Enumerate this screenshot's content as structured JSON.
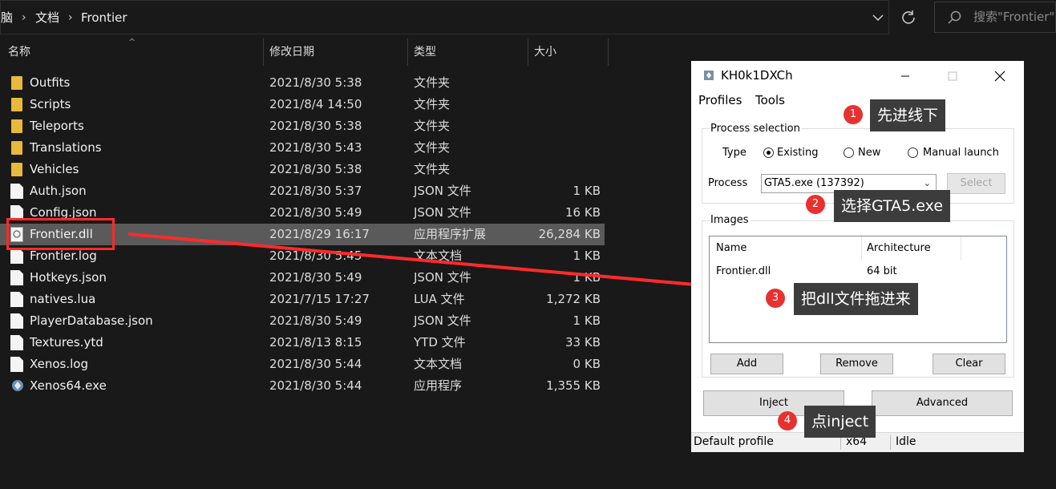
{
  "explorer": {
    "breadcrumb": [
      "脑",
      "文档",
      "Frontier"
    ],
    "search_placeholder": "搜索\"Frontier\"",
    "columns": {
      "name": "名称",
      "date": "修改日期",
      "type": "类型",
      "size": "大小"
    },
    "files": [
      {
        "name": "Outfits",
        "date": "2021/8/30 5:38",
        "type": "文件夹",
        "size": "",
        "kind": "folder"
      },
      {
        "name": "Scripts",
        "date": "2021/8/4 14:50",
        "type": "文件夹",
        "size": "",
        "kind": "folder"
      },
      {
        "name": "Teleports",
        "date": "2021/8/30 5:38",
        "type": "文件夹",
        "size": "",
        "kind": "folder"
      },
      {
        "name": "Translations",
        "date": "2021/8/30 5:43",
        "type": "文件夹",
        "size": "",
        "kind": "folder"
      },
      {
        "name": "Vehicles",
        "date": "2021/8/30 5:38",
        "type": "文件夹",
        "size": "",
        "kind": "folder"
      },
      {
        "name": "Auth.json",
        "date": "2021/8/30 5:37",
        "type": "JSON 文件",
        "size": "1 KB",
        "kind": "file"
      },
      {
        "name": "Config.json",
        "date": "2021/8/30 5:49",
        "type": "JSON 文件",
        "size": "16 KB",
        "kind": "file"
      },
      {
        "name": "Frontier.dll",
        "date": "2021/8/29 16:17",
        "type": "应用程序扩展",
        "size": "26,284 KB",
        "kind": "dll"
      },
      {
        "name": "Frontier.log",
        "date": "2021/8/30 5:45",
        "type": "文本文档",
        "size": "1 KB",
        "kind": "file"
      },
      {
        "name": "Hotkeys.json",
        "date": "2021/8/30 5:49",
        "type": "JSON 文件",
        "size": "1 KB",
        "kind": "file"
      },
      {
        "name": "natives.lua",
        "date": "2021/7/15 17:27",
        "type": "LUA 文件",
        "size": "1,272 KB",
        "kind": "file"
      },
      {
        "name": "PlayerDatabase.json",
        "date": "2021/8/30 5:49",
        "type": "JSON 文件",
        "size": "1 KB",
        "kind": "file"
      },
      {
        "name": "Textures.ytd",
        "date": "2021/8/13 8:15",
        "type": "YTD 文件",
        "size": "33 KB",
        "kind": "file"
      },
      {
        "name": "Xenos.log",
        "date": "2021/8/30 5:44",
        "type": "文本文档",
        "size": "0 KB",
        "kind": "file"
      },
      {
        "name": "Xenos64.exe",
        "date": "2021/8/30 5:44",
        "type": "应用程序",
        "size": "1,355 KB",
        "kind": "exe"
      }
    ],
    "selected_file": "Frontier.dll"
  },
  "dialog": {
    "title": "KH0k1DXCh",
    "menu": [
      "Profiles",
      "Tools"
    ],
    "process_selection": {
      "label": "Process selection",
      "type_label": "Type",
      "options": [
        "Existing",
        "New",
        "Manual launch"
      ],
      "selected_option": "Existing",
      "process_label": "Process",
      "process_value": "GTA5.exe (137392)",
      "select_button": "Select"
    },
    "images": {
      "label": "Images",
      "columns": [
        "Name",
        "Architecture"
      ],
      "rows": [
        {
          "name": "Frontier.dll",
          "arch": "64 bit"
        }
      ],
      "buttons": [
        "Add",
        "Remove",
        "Clear"
      ]
    },
    "inject_button": "Inject",
    "advanced_button": "Advanced",
    "status": {
      "profile": "Default profile",
      "arch": "x64",
      "state": "Idle"
    }
  },
  "annotations": [
    {
      "num": "1",
      "text": "先进线下"
    },
    {
      "num": "2",
      "text": "选择GTA5.exe"
    },
    {
      "num": "3",
      "text": "把dll文件拖进来"
    },
    {
      "num": "4",
      "text": "点inject"
    }
  ],
  "colors": {
    "highlight_red": "#ff2a2a",
    "badge_red": "#e8312f",
    "callout_bg": "#3c3c3c",
    "selected_row": "#5a5a5a"
  }
}
